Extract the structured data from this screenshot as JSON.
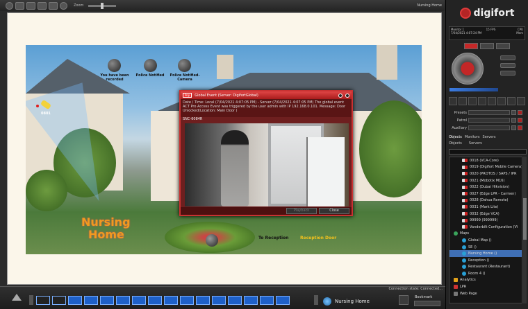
{
  "toolbar": {
    "zoom_label": "Zoom",
    "map_tab_label": "Nursing Home"
  },
  "map": {
    "overlay_labels": {
      "recorded": "You have been recorded",
      "police_notified": "Police Notified",
      "police_camera": "Police Notified-Camera"
    },
    "camera_label": "0801",
    "title_line1": "Nursing",
    "title_line2": "Home",
    "to_reception": "To Reception",
    "reception_door": "Reception Door"
  },
  "popup": {
    "badge": "Pop",
    "title": "Global Event (Server: DigifortGlobal)",
    "message": "Date / Time: Local (7/04/2021 4:07:05 PM) - Server (7/04/2021 4:07:05 PM)\nThe global event ACT Pro Access Event was triggered by the user admin with IP 192.168.0.101. Message: Door Unlocked(Location: Main Door )",
    "camera": "SNC-6084R",
    "playback_label": "Playback",
    "close_label": "Close"
  },
  "right_panel": {
    "logo_text": "digifort",
    "monitor_info": {
      "monitor": "Monitor 1",
      "fps": "15 FPS",
      "cpu": "CPU",
      "datetime": "7/04/2021 4:07:24 PM",
      "mem": "Mem"
    },
    "ptz_rows": [
      "Presets",
      "Patrol",
      "Auxiliary"
    ],
    "tree_tabs": [
      "Objects",
      "Monitors",
      "Servers"
    ],
    "tree_filter": [
      "Objects",
      "Servers"
    ],
    "tree_items": [
      {
        "label": "0018 (VCA-Core)",
        "icon": "cam",
        "selected": false
      },
      {
        "label": "0019 (Digifort Mobile Camera)",
        "icon": "cam",
        "selected": false
      },
      {
        "label": "0020 (PROTOS / SAPS / IPR",
        "icon": "cam",
        "selected": false
      },
      {
        "label": "0021 (Mobotix M16)",
        "icon": "cam",
        "selected": false
      },
      {
        "label": "0022 (Dubai Hikvision)",
        "icon": "cam",
        "selected": false
      },
      {
        "label": "0027 (Edge LPR - Carmen)",
        "icon": "cam",
        "selected": false
      },
      {
        "label": "0028 (Dahua Remote)",
        "icon": "cam",
        "selected": false
      },
      {
        "label": "0031 (Mark Lite)",
        "icon": "cam",
        "selected": false
      },
      {
        "label": "0032 (Edge VCA)",
        "icon": "cam",
        "selected": false
      },
      {
        "label": "99999 (999999)",
        "icon": "cam",
        "selected": false
      },
      {
        "label": "Vanderbilt Configuration (Vi",
        "icon": "cam",
        "selected": false
      },
      {
        "label": "Maps",
        "icon": "folder",
        "selected": false
      },
      {
        "label": "Global Map ()",
        "icon": "map",
        "selected": false
      },
      {
        "label": "SE ()",
        "icon": "map",
        "selected": false
      },
      {
        "label": "Nursing Home ()",
        "icon": "map",
        "selected": true
      },
      {
        "label": "Reception ()",
        "icon": "map",
        "selected": false
      },
      {
        "label": "Restaurant (Restaurant)",
        "icon": "map",
        "selected": false
      },
      {
        "label": "Room 4 ()",
        "icon": "map",
        "selected": false
      },
      {
        "label": "Analytics",
        "icon": "ana",
        "selected": false
      },
      {
        "label": "LPR",
        "icon": "lpr",
        "selected": false
      },
      {
        "label": "Web Page",
        "icon": "web",
        "selected": false
      }
    ]
  },
  "bottom_bar": {
    "connection_state": "Connection state: Connected...",
    "map_indicator": "Nursing Home",
    "bookmark_label": "Bookmark"
  },
  "colors": {
    "accent_red": "#c62828",
    "selection_blue": "#3f6fb5",
    "nursing_home_orange": "#f29a1f"
  }
}
